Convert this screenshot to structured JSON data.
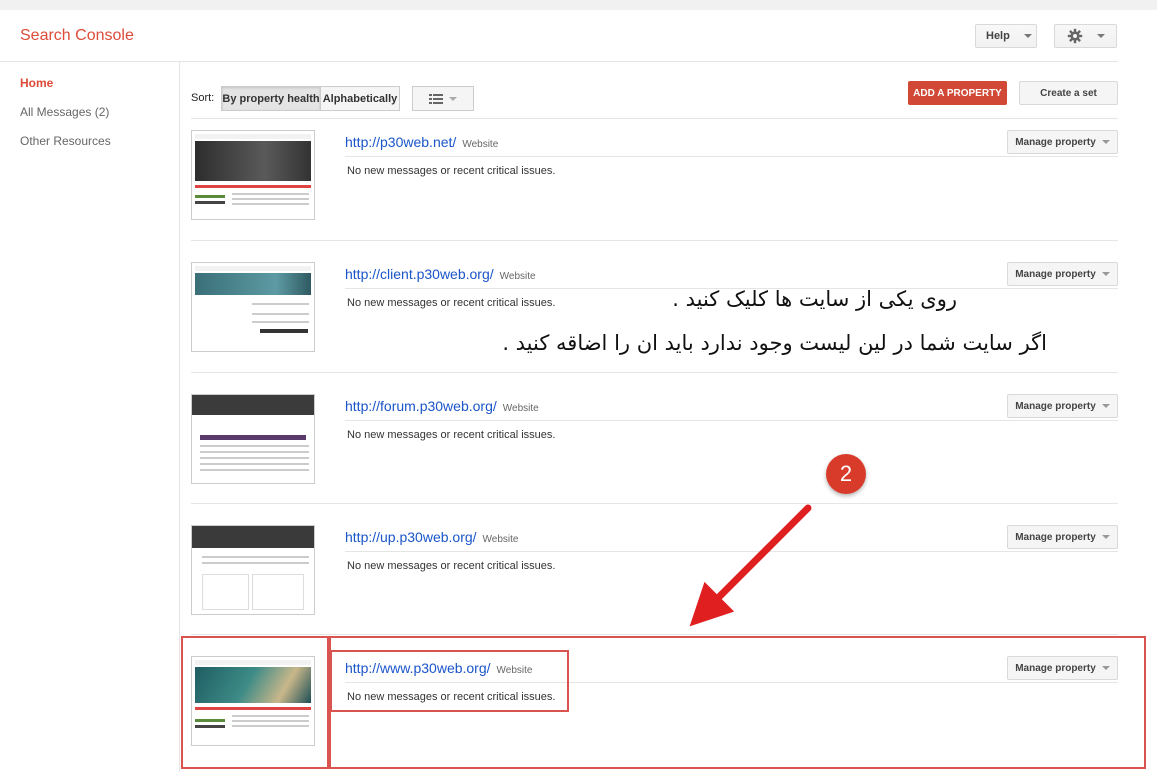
{
  "header": {
    "brand": "Search Console",
    "help_label": "Help",
    "settings_icon": "gear-icon"
  },
  "sidebar": {
    "items": [
      {
        "label": "Home",
        "active": true
      },
      {
        "label": "All Messages (2)",
        "active": false
      },
      {
        "label": "Other Resources",
        "active": false
      }
    ]
  },
  "toolbar": {
    "sort_label": "Sort:",
    "sort_by_health": "By property health",
    "sort_alpha": "Alphabetically",
    "view_icon": "list-view-icon",
    "add_property": "ADD A PROPERTY",
    "create_set": "Create a set"
  },
  "properties": [
    {
      "url": "http://p30web.net/",
      "type": "Website",
      "message": "No new messages or recent critical issues.",
      "manage": "Manage property"
    },
    {
      "url": "http://client.p30web.org/",
      "type": "Website",
      "message": "No new messages or recent critical issues.",
      "manage": "Manage property"
    },
    {
      "url": "http://forum.p30web.org/",
      "type": "Website",
      "message": "No new messages or recent critical issues.",
      "manage": "Manage property"
    },
    {
      "url": "http://up.p30web.org/",
      "type": "Website",
      "message": "No new messages or recent critical issues.",
      "manage": "Manage property"
    },
    {
      "url": "http://www.p30web.org/",
      "type": "Website",
      "message": "No new messages or recent critical issues.",
      "manage": "Manage property"
    }
  ],
  "annotation": {
    "line1": "روی یکی از سایت ها کلیک کنید .",
    "line2": "اگر سایت شما در لین لیست وجود ندارد باید ان را اضاقه کنید .",
    "step_number": "2",
    "accent_color": "#dd4b39",
    "arrow_color": "#e02020"
  }
}
